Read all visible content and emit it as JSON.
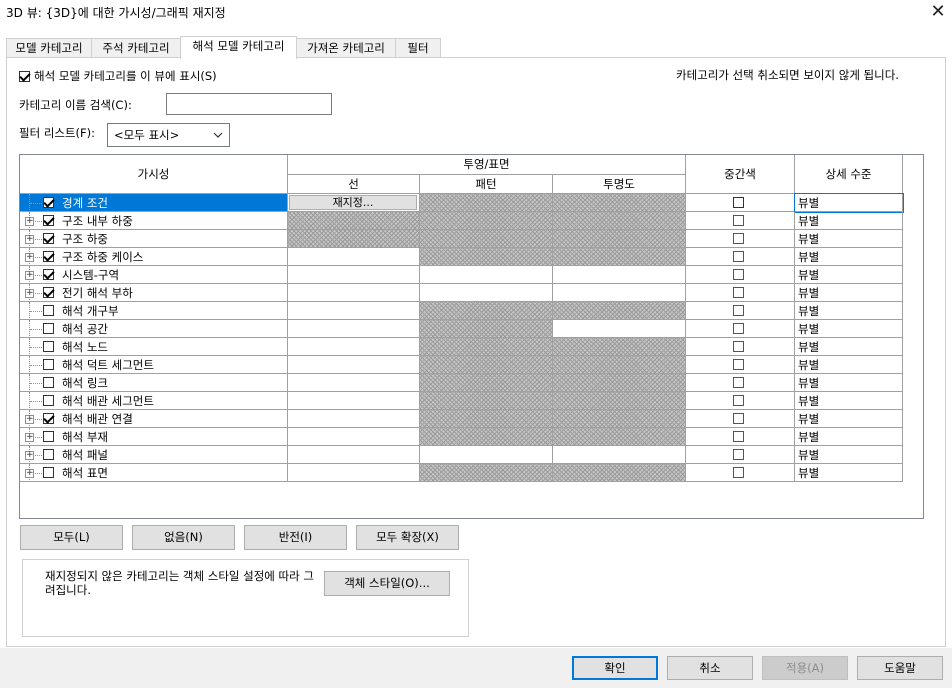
{
  "window": {
    "title": "3D 뷰: {3D}에 대한 가시성/그래픽 재지정",
    "close_glyph": "✕"
  },
  "tabs": [
    {
      "label": "모델 카테고리",
      "active": false
    },
    {
      "label": "주석 카테고리",
      "active": false
    },
    {
      "label": "해석 모델 카테고리",
      "active": true
    },
    {
      "label": "가져온 카테고리",
      "active": false
    },
    {
      "label": "필터",
      "active": false
    }
  ],
  "panel": {
    "show_checkbox_label": "해석 모델 카테고리를 이 뷰에 표시(S)",
    "show_checked": true,
    "hint": "카테고리가 선택 취소되면 보이지 않게 됩니다.",
    "search_label": "카테고리 이름 검색(C):",
    "search_value": "",
    "filter_label": "필터 리스트(F):",
    "filter_value": "<모두 표시>"
  },
  "table": {
    "headers": {
      "visibility": "가시성",
      "projection_surface": "투영/표면",
      "line": "선",
      "pattern": "패턴",
      "transparency": "투명도",
      "halftone": "중간색",
      "detail_level": "상세 수준"
    },
    "rows": [
      {
        "name": "경계 조건",
        "checked": true,
        "expand": false,
        "selected": true,
        "line_override": "재지정...",
        "line_hatch": false,
        "pattern_hatch": true,
        "transparency_hatch": true,
        "halftone": false,
        "detail": "뷰별"
      },
      {
        "name": "구조 내부 하중",
        "checked": true,
        "expand": true,
        "selected": false,
        "line_override": "",
        "line_hatch": true,
        "pattern_hatch": true,
        "transparency_hatch": true,
        "halftone": false,
        "detail": "뷰별"
      },
      {
        "name": "구조 하중",
        "checked": true,
        "expand": true,
        "selected": false,
        "line_override": "",
        "line_hatch": true,
        "pattern_hatch": true,
        "transparency_hatch": true,
        "halftone": false,
        "detail": "뷰별"
      },
      {
        "name": "구조 하중 케이스",
        "checked": true,
        "expand": true,
        "selected": false,
        "line_override": "",
        "line_hatch": false,
        "pattern_hatch": true,
        "transparency_hatch": true,
        "halftone": false,
        "detail": "뷰별"
      },
      {
        "name": "시스템-구역",
        "checked": true,
        "expand": true,
        "selected": false,
        "line_override": "",
        "line_hatch": false,
        "pattern_hatch": false,
        "transparency_hatch": false,
        "halftone": false,
        "detail": "뷰별"
      },
      {
        "name": "전기 해석 부하",
        "checked": true,
        "expand": true,
        "selected": false,
        "line_override": "",
        "line_hatch": false,
        "pattern_hatch": false,
        "transparency_hatch": false,
        "halftone": false,
        "detail": "뷰별"
      },
      {
        "name": "해석 개구부",
        "checked": false,
        "expand": false,
        "selected": false,
        "line_override": "",
        "line_hatch": false,
        "pattern_hatch": true,
        "transparency_hatch": true,
        "halftone": false,
        "detail": "뷰별"
      },
      {
        "name": "해석 공간",
        "checked": false,
        "expand": false,
        "selected": false,
        "line_override": "",
        "line_hatch": false,
        "pattern_hatch": true,
        "transparency_hatch": false,
        "halftone": false,
        "detail": "뷰별"
      },
      {
        "name": "해석 노드",
        "checked": false,
        "expand": false,
        "selected": false,
        "line_override": "",
        "line_hatch": false,
        "pattern_hatch": true,
        "transparency_hatch": true,
        "halftone": false,
        "detail": "뷰별"
      },
      {
        "name": "해석 덕트 세그먼트",
        "checked": false,
        "expand": false,
        "selected": false,
        "line_override": "",
        "line_hatch": false,
        "pattern_hatch": true,
        "transparency_hatch": true,
        "halftone": false,
        "detail": "뷰별"
      },
      {
        "name": "해석 링크",
        "checked": false,
        "expand": false,
        "selected": false,
        "line_override": "",
        "line_hatch": false,
        "pattern_hatch": true,
        "transparency_hatch": true,
        "halftone": false,
        "detail": "뷰별"
      },
      {
        "name": "해석 배관 세그먼트",
        "checked": false,
        "expand": false,
        "selected": false,
        "line_override": "",
        "line_hatch": false,
        "pattern_hatch": true,
        "transparency_hatch": true,
        "halftone": false,
        "detail": "뷰별"
      },
      {
        "name": "해석 배관 연결",
        "checked": true,
        "expand": true,
        "selected": false,
        "line_override": "",
        "line_hatch": false,
        "pattern_hatch": true,
        "transparency_hatch": true,
        "halftone": false,
        "detail": "뷰별"
      },
      {
        "name": "해석 부재",
        "checked": false,
        "expand": true,
        "selected": false,
        "line_override": "",
        "line_hatch": false,
        "pattern_hatch": true,
        "transparency_hatch": true,
        "halftone": false,
        "detail": "뷰별"
      },
      {
        "name": "해석 패널",
        "checked": false,
        "expand": true,
        "selected": false,
        "line_override": "",
        "line_hatch": false,
        "pattern_hatch": false,
        "transparency_hatch": false,
        "halftone": false,
        "detail": "뷰별"
      },
      {
        "name": "해석 표면",
        "checked": false,
        "expand": true,
        "selected": false,
        "line_override": "",
        "line_hatch": false,
        "pattern_hatch": true,
        "transparency_hatch": true,
        "halftone": false,
        "detail": "뷰별"
      }
    ]
  },
  "buttons": {
    "all": "모두(L)",
    "none": "없음(N)",
    "invert": "반전(I)",
    "expand_all": "모두 확장(X)",
    "object_styles": "객체 스타일(O)...",
    "ok": "확인",
    "cancel": "취소",
    "apply": "적용(A)",
    "help": "도움말"
  },
  "note": {
    "text": "재지정되지 않은 카테고리는 객체 스타일 설정에 따라 그려집니다."
  },
  "colors": {
    "selection": "#0078d7",
    "ok_border": "#0078d7",
    "hatch": "#9a9a9a"
  }
}
